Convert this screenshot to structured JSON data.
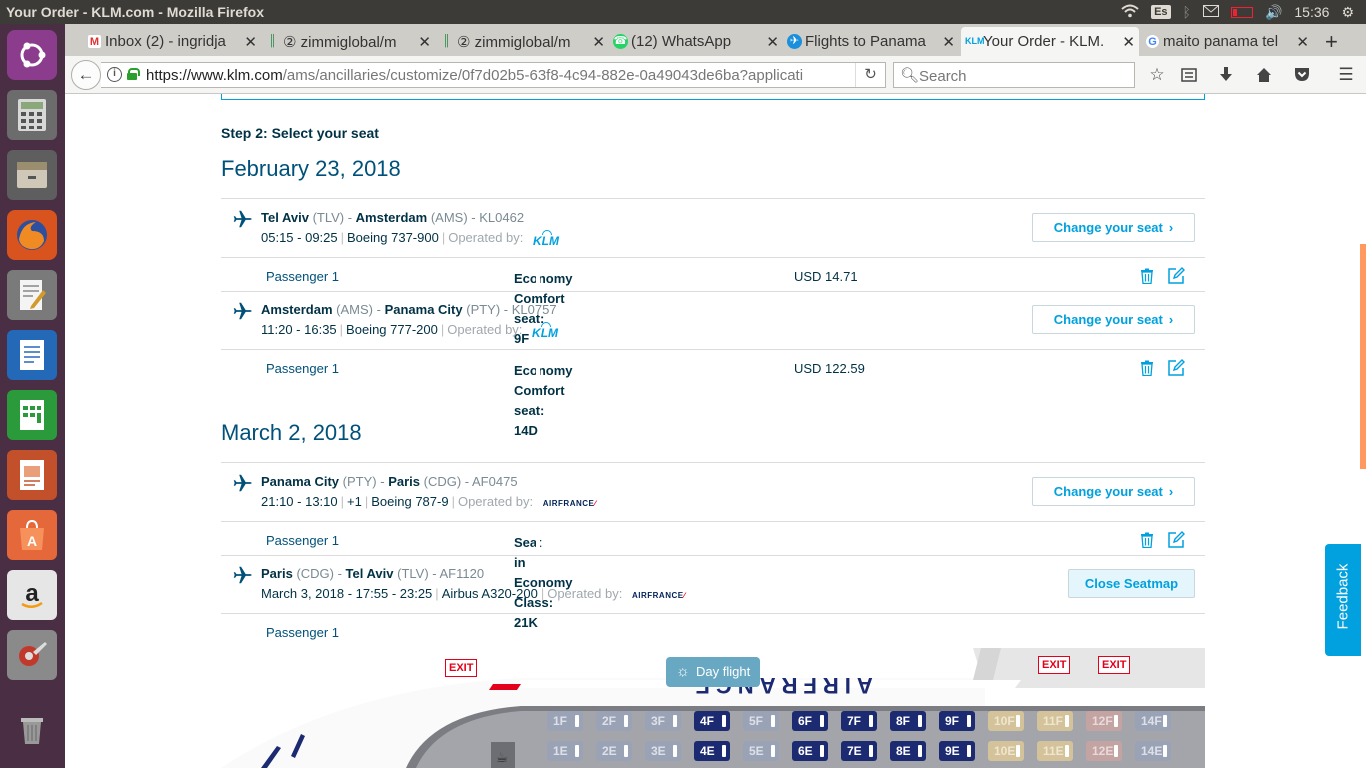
{
  "system": {
    "window_title": "Your Order - KLM.com - Mozilla Firefox",
    "keyboard_layout": "Es",
    "time": "15:36"
  },
  "launcher": {
    "items": [
      "ubuntu-dash-icon",
      "calculator-icon",
      "file-manager-icon",
      "firefox-icon",
      "text-editor-icon",
      "writer-icon",
      "calc-icon",
      "impress-icon",
      "software-center-icon",
      "amazon-icon",
      "system-settings-icon",
      "trash-icon"
    ]
  },
  "tabs": [
    {
      "label": "Inbox (2) - ingridja",
      "icon": "gmail-icon"
    },
    {
      "label": "② zimmiglobal/m",
      "icon": "zimmi-icon"
    },
    {
      "label": "② zimmiglobal/m",
      "icon": "zimmi-icon"
    },
    {
      "label": "(12) WhatsApp",
      "icon": "whatsapp-icon"
    },
    {
      "label": "Flights to Panama",
      "icon": "plane-icon"
    },
    {
      "label": "Your Order - KLM.",
      "icon": "klm-icon",
      "active": true
    },
    {
      "label": "maito panama tel",
      "icon": "google-icon"
    }
  ],
  "navbar": {
    "url_domain": "https://www.klm.com",
    "url_path": "/ams/ancillaries/customize/0f7d02b5-63f8-4c94-882e-0a49043de6ba?applicati",
    "search_placeholder": "Search"
  },
  "page": {
    "step_label": "Step 2: Select your seat",
    "change_seat_label": "Change your seat",
    "close_seatmap_label": "Close Seatmap",
    "operated_by_label": "Operated by:",
    "feedback_label": "Feedback",
    "dates": [
      {
        "date": "February 23, 2018",
        "segments": [
          {
            "from_city": "Tel Aviv",
            "from_code": "(TLV)",
            "to_city": "Amsterdam",
            "to_code": "(AMS)",
            "flight_no": "KL0462",
            "times": "05:15 - 09:25",
            "aircraft": "Boeing 737-900",
            "carrier": "KLM",
            "passenger": "Passenger 1",
            "seat": "Economy Comfort seat: 9F",
            "price": "USD 14.71"
          },
          {
            "from_city": "Amsterdam",
            "from_code": "(AMS)",
            "to_city": "Panama City",
            "to_code": "(PTY)",
            "flight_no": "KL0757",
            "times": "11:20 - 16:35",
            "aircraft": "Boeing 777-200",
            "carrier": "KLM",
            "passenger": "Passenger 1",
            "seat": "Economy Comfort seat: 14D",
            "price": "USD 122.59"
          }
        ]
      },
      {
        "date": "March 2, 2018",
        "segments": [
          {
            "from_city": "Panama City",
            "from_code": "(PTY)",
            "to_city": "Paris",
            "to_code": "(CDG)",
            "flight_no": "AF0475",
            "times": "21:10 - 13:10",
            "day_offset": "+1",
            "aircraft": "Boeing 787-9",
            "carrier": "AIRFRANCE",
            "passenger": "Passenger 1",
            "seat": "Seat in Economy Class: 21K",
            "price": ""
          },
          {
            "from_city": "Paris",
            "from_code": "(CDG)",
            "to_city": "Tel Aviv",
            "to_code": "(TLV)",
            "flight_no": "AF1120",
            "date_prefix": "March 3, 2018",
            "times": "17:55 - 23:25",
            "aircraft": "Airbus A320-200",
            "carrier": "AIRFRANCE",
            "passenger": "Passenger 1"
          }
        ]
      }
    ]
  },
  "seatmap": {
    "day_label": "Day flight",
    "exit_label": "EXIT",
    "row_f": [
      "1F",
      "2F",
      "3F",
      "4F",
      "5F",
      "6F",
      "7F",
      "8F",
      "9F",
      "10F",
      "11F",
      "12F",
      "14F"
    ],
    "row_e": [
      "1E",
      "2E",
      "3E",
      "4E",
      "5E",
      "6E",
      "7E",
      "8E",
      "9E",
      "10E",
      "11E",
      "12E",
      "14E"
    ],
    "seat_states": [
      "na",
      "na",
      "na",
      "avail",
      "na",
      "avail",
      "avail",
      "avail",
      "avail",
      "warm",
      "warm",
      "extra",
      "na"
    ]
  }
}
